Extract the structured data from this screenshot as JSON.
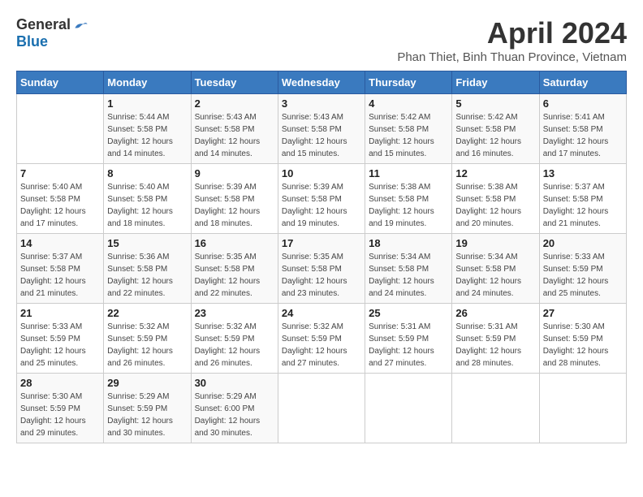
{
  "header": {
    "logo_general": "General",
    "logo_blue": "Blue",
    "title": "April 2024",
    "location": "Phan Thiet, Binh Thuan Province, Vietnam"
  },
  "calendar": {
    "headers": [
      "Sunday",
      "Monday",
      "Tuesday",
      "Wednesday",
      "Thursday",
      "Friday",
      "Saturday"
    ],
    "weeks": [
      [
        {
          "day": "",
          "sunrise": "",
          "sunset": "",
          "daylight": ""
        },
        {
          "day": "1",
          "sunrise": "Sunrise: 5:44 AM",
          "sunset": "Sunset: 5:58 PM",
          "daylight": "Daylight: 12 hours and 14 minutes."
        },
        {
          "day": "2",
          "sunrise": "Sunrise: 5:43 AM",
          "sunset": "Sunset: 5:58 PM",
          "daylight": "Daylight: 12 hours and 14 minutes."
        },
        {
          "day": "3",
          "sunrise": "Sunrise: 5:43 AM",
          "sunset": "Sunset: 5:58 PM",
          "daylight": "Daylight: 12 hours and 15 minutes."
        },
        {
          "day": "4",
          "sunrise": "Sunrise: 5:42 AM",
          "sunset": "Sunset: 5:58 PM",
          "daylight": "Daylight: 12 hours and 15 minutes."
        },
        {
          "day": "5",
          "sunrise": "Sunrise: 5:42 AM",
          "sunset": "Sunset: 5:58 PM",
          "daylight": "Daylight: 12 hours and 16 minutes."
        },
        {
          "day": "6",
          "sunrise": "Sunrise: 5:41 AM",
          "sunset": "Sunset: 5:58 PM",
          "daylight": "Daylight: 12 hours and 17 minutes."
        }
      ],
      [
        {
          "day": "7",
          "sunrise": "Sunrise: 5:40 AM",
          "sunset": "Sunset: 5:58 PM",
          "daylight": "Daylight: 12 hours and 17 minutes."
        },
        {
          "day": "8",
          "sunrise": "Sunrise: 5:40 AM",
          "sunset": "Sunset: 5:58 PM",
          "daylight": "Daylight: 12 hours and 18 minutes."
        },
        {
          "day": "9",
          "sunrise": "Sunrise: 5:39 AM",
          "sunset": "Sunset: 5:58 PM",
          "daylight": "Daylight: 12 hours and 18 minutes."
        },
        {
          "day": "10",
          "sunrise": "Sunrise: 5:39 AM",
          "sunset": "Sunset: 5:58 PM",
          "daylight": "Daylight: 12 hours and 19 minutes."
        },
        {
          "day": "11",
          "sunrise": "Sunrise: 5:38 AM",
          "sunset": "Sunset: 5:58 PM",
          "daylight": "Daylight: 12 hours and 19 minutes."
        },
        {
          "day": "12",
          "sunrise": "Sunrise: 5:38 AM",
          "sunset": "Sunset: 5:58 PM",
          "daylight": "Daylight: 12 hours and 20 minutes."
        },
        {
          "day": "13",
          "sunrise": "Sunrise: 5:37 AM",
          "sunset": "Sunset: 5:58 PM",
          "daylight": "Daylight: 12 hours and 21 minutes."
        }
      ],
      [
        {
          "day": "14",
          "sunrise": "Sunrise: 5:37 AM",
          "sunset": "Sunset: 5:58 PM",
          "daylight": "Daylight: 12 hours and 21 minutes."
        },
        {
          "day": "15",
          "sunrise": "Sunrise: 5:36 AM",
          "sunset": "Sunset: 5:58 PM",
          "daylight": "Daylight: 12 hours and 22 minutes."
        },
        {
          "day": "16",
          "sunrise": "Sunrise: 5:35 AM",
          "sunset": "Sunset: 5:58 PM",
          "daylight": "Daylight: 12 hours and 22 minutes."
        },
        {
          "day": "17",
          "sunrise": "Sunrise: 5:35 AM",
          "sunset": "Sunset: 5:58 PM",
          "daylight": "Daylight: 12 hours and 23 minutes."
        },
        {
          "day": "18",
          "sunrise": "Sunrise: 5:34 AM",
          "sunset": "Sunset: 5:58 PM",
          "daylight": "Daylight: 12 hours and 24 minutes."
        },
        {
          "day": "19",
          "sunrise": "Sunrise: 5:34 AM",
          "sunset": "Sunset: 5:58 PM",
          "daylight": "Daylight: 12 hours and 24 minutes."
        },
        {
          "day": "20",
          "sunrise": "Sunrise: 5:33 AM",
          "sunset": "Sunset: 5:59 PM",
          "daylight": "Daylight: 12 hours and 25 minutes."
        }
      ],
      [
        {
          "day": "21",
          "sunrise": "Sunrise: 5:33 AM",
          "sunset": "Sunset: 5:59 PM",
          "daylight": "Daylight: 12 hours and 25 minutes."
        },
        {
          "day": "22",
          "sunrise": "Sunrise: 5:32 AM",
          "sunset": "Sunset: 5:59 PM",
          "daylight": "Daylight: 12 hours and 26 minutes."
        },
        {
          "day": "23",
          "sunrise": "Sunrise: 5:32 AM",
          "sunset": "Sunset: 5:59 PM",
          "daylight": "Daylight: 12 hours and 26 minutes."
        },
        {
          "day": "24",
          "sunrise": "Sunrise: 5:32 AM",
          "sunset": "Sunset: 5:59 PM",
          "daylight": "Daylight: 12 hours and 27 minutes."
        },
        {
          "day": "25",
          "sunrise": "Sunrise: 5:31 AM",
          "sunset": "Sunset: 5:59 PM",
          "daylight": "Daylight: 12 hours and 27 minutes."
        },
        {
          "day": "26",
          "sunrise": "Sunrise: 5:31 AM",
          "sunset": "Sunset: 5:59 PM",
          "daylight": "Daylight: 12 hours and 28 minutes."
        },
        {
          "day": "27",
          "sunrise": "Sunrise: 5:30 AM",
          "sunset": "Sunset: 5:59 PM",
          "daylight": "Daylight: 12 hours and 28 minutes."
        }
      ],
      [
        {
          "day": "28",
          "sunrise": "Sunrise: 5:30 AM",
          "sunset": "Sunset: 5:59 PM",
          "daylight": "Daylight: 12 hours and 29 minutes."
        },
        {
          "day": "29",
          "sunrise": "Sunrise: 5:29 AM",
          "sunset": "Sunset: 5:59 PM",
          "daylight": "Daylight: 12 hours and 30 minutes."
        },
        {
          "day": "30",
          "sunrise": "Sunrise: 5:29 AM",
          "sunset": "Sunset: 6:00 PM",
          "daylight": "Daylight: 12 hours and 30 minutes."
        },
        {
          "day": "",
          "sunrise": "",
          "sunset": "",
          "daylight": ""
        },
        {
          "day": "",
          "sunrise": "",
          "sunset": "",
          "daylight": ""
        },
        {
          "day": "",
          "sunrise": "",
          "sunset": "",
          "daylight": ""
        },
        {
          "day": "",
          "sunrise": "",
          "sunset": "",
          "daylight": ""
        }
      ]
    ]
  }
}
